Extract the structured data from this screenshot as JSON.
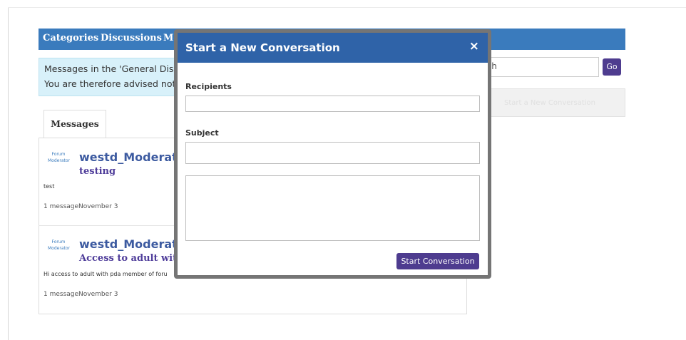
{
  "nav": {
    "items": [
      "Categories",
      "Discussions",
      "Me"
    ]
  },
  "banner": {
    "line1": "Messages in the 'General Disc",
    "line2": "You are therefore advised not"
  },
  "search": {
    "value": "rch",
    "go_label": "Go"
  },
  "sidebar": {
    "new_conversation_label": "Start a New Conversation"
  },
  "messages": {
    "tab_label": "Messages",
    "logo_text_top": "Forum",
    "logo_text_bottom": "Moderator",
    "items": [
      {
        "author": "westd_Moderator",
        "subject": "testing",
        "body": "test",
        "count": "1 message",
        "date": "November 3"
      },
      {
        "author": "westd_Moderator",
        "subject": "Access to adult with Pl",
        "body": "Hi access to adult with pda member of foru",
        "count": "1 message",
        "date": "November 3"
      }
    ]
  },
  "modal": {
    "title": "Start a New Conversation",
    "close_label": "×",
    "recipients_label": "Recipients",
    "recipients_value": "",
    "subject_label": "Subject",
    "subject_value": "",
    "body_value": "",
    "submit_label": "Start Conversation"
  },
  "colors": {
    "nav_bg": "#3a7bbd",
    "modal_header": "#2f63a8",
    "button_purple": "#4e3c8f",
    "subject_purple": "#4f3d9a",
    "banner_bg": "#d8f1fa"
  }
}
